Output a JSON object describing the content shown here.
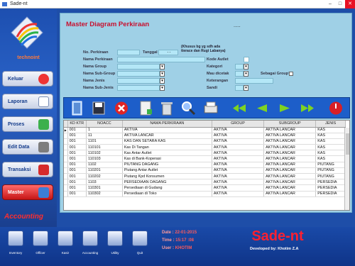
{
  "window": {
    "title": "Sade-nt"
  },
  "sidebar": {
    "logo_text": "technoint",
    "items": [
      {
        "label": "Keluar",
        "icon": "power-icon",
        "color": "#d81f26"
      },
      {
        "label": "Laporan",
        "icon": "report-icon",
        "color": "#2d6fd1"
      },
      {
        "label": "Proses",
        "icon": "process-icon",
        "color": "#2aa33d"
      },
      {
        "label": "Edit Data",
        "icon": "edit-icon",
        "color": "#7a3db2"
      },
      {
        "label": "Transaksi",
        "icon": "transaction-icon",
        "color": "#d62b2b"
      },
      {
        "label": "Master",
        "icon": "master-icon",
        "color": "#3b7ed6",
        "active": true
      }
    ],
    "footer": "Accounting"
  },
  "form": {
    "title": "Master Diagram Perkiraan",
    "dots": ".....",
    "no_perkiraan_label": "No. Perkiraan",
    "tanggal_label": "Tanggal",
    "tanggal_value": "- -",
    "note": "(Khusus bg yg sdh ada\ntterace dan Rugi Labanya)",
    "nama_perkiraan_label": "Nama Perkiraan",
    "nama_group_label": "Nama Group",
    "nama_sub_group_label": "Nama Sub-Group",
    "nama_jenis_label": "Nama Jenis",
    "nama_sub_jenis_label": "Nama Sub-Jenis",
    "kode_autlet_label": "Kode Autlet",
    "kategori_label": "Kategori",
    "mau_dicetak_label": "Mau dicetak",
    "sebagai_group_label": "Sebagai Group?",
    "keterangan_label": "Keterangan",
    "sandi_label": "Sandi"
  },
  "toolbar": {
    "icons": [
      "exit-door-icon",
      "save-icon",
      "cancel-icon",
      "add-document-icon",
      "delete-trash-icon",
      "find-icon",
      "print-icon",
      "first-record-icon",
      "previous-record-icon",
      "next-record-icon",
      "last-record-icon",
      "refresh-power-icon"
    ]
  },
  "grid": {
    "columns": [
      "KD KTR",
      "NOACC",
      "NAMA PERKIRAAN",
      "GROUP",
      "SUBGROUP",
      "JENIS"
    ],
    "rows": [
      [
        "001",
        "1",
        "AKTIVA",
        "AKTIVA",
        "AKTIVA LANCAR",
        "KAS"
      ],
      [
        "001",
        "11",
        "AKTIVA LANCAR",
        "AKTIVA",
        "AKTIVA LANCAR",
        "KAS"
      ],
      [
        "001",
        "1101",
        "KAS DAN SETARA KAS",
        "AKTIVA",
        "AKTIVA LANCAR",
        "KAS"
      ],
      [
        "001",
        "110101",
        "Kas Di Tangan",
        "AKTIVA",
        "AKTIVA LANCAR",
        "KAS"
      ],
      [
        "001",
        "110102",
        "Kas Antar Autlet",
        "AKTIVA",
        "AKTIVA LANCAR",
        "KAS"
      ],
      [
        "001",
        "110103",
        "Kas di Bank-Koperasi",
        "AKTIVA",
        "AKTIVA LANCAR",
        "KAS"
      ],
      [
        "001",
        "1102",
        "PIUTANG DAGANG",
        "AKTIVA",
        "AKTIVA LANCAR",
        "PIUTANG"
      ],
      [
        "001",
        "110201",
        "Piutang Antar Autlet",
        "AKTIVA",
        "AKTIVA LANCAR",
        "PIUTANG"
      ],
      [
        "001",
        "110202",
        "Piutang Kpd Konsumen",
        "AKTIVA",
        "AKTIVA LANCAR",
        "PIUTANG"
      ],
      [
        "001",
        "1103",
        "PERSEDIAAN DAGANG",
        "AKTIVA",
        "AKTIVA LANCAR",
        "PERSEDIA"
      ],
      [
        "001",
        "110301",
        "Persediaan di Gudang",
        "AKTIVA",
        "AKTIVA LANCAR",
        "PERSEDIA"
      ],
      [
        "001",
        "110302",
        "Persediaan di Toko",
        "AKTIVA",
        "AKTIVA LANCAR",
        "PERSEDIA"
      ]
    ]
  },
  "bottom": {
    "icons": [
      {
        "label": "Inventory",
        "icon": "inventory-icon"
      },
      {
        "label": "Officer",
        "icon": "officer-icon"
      },
      {
        "label": "Kasir",
        "icon": "cashier-icon"
      },
      {
        "label": "Accounting",
        "icon": "accounting-icon"
      },
      {
        "label": "Utility",
        "icon": "utility-icon"
      },
      {
        "label": "Quit",
        "icon": "quit-icon"
      }
    ],
    "date_label": "Date :",
    "date_value": "22-01-2015",
    "time_label": "Time :",
    "time_value": "15:17 :08",
    "user_label": "User :",
    "user_value": "KHOTIM",
    "brand": "Sade-nt",
    "developer": "Developed by: Khotim Z.A"
  },
  "colors": {
    "panel_bg": "#9fd0e6",
    "sidebar_bg": "#1d4fb0",
    "heading": "#c8102e",
    "brand": "#ff2030"
  }
}
